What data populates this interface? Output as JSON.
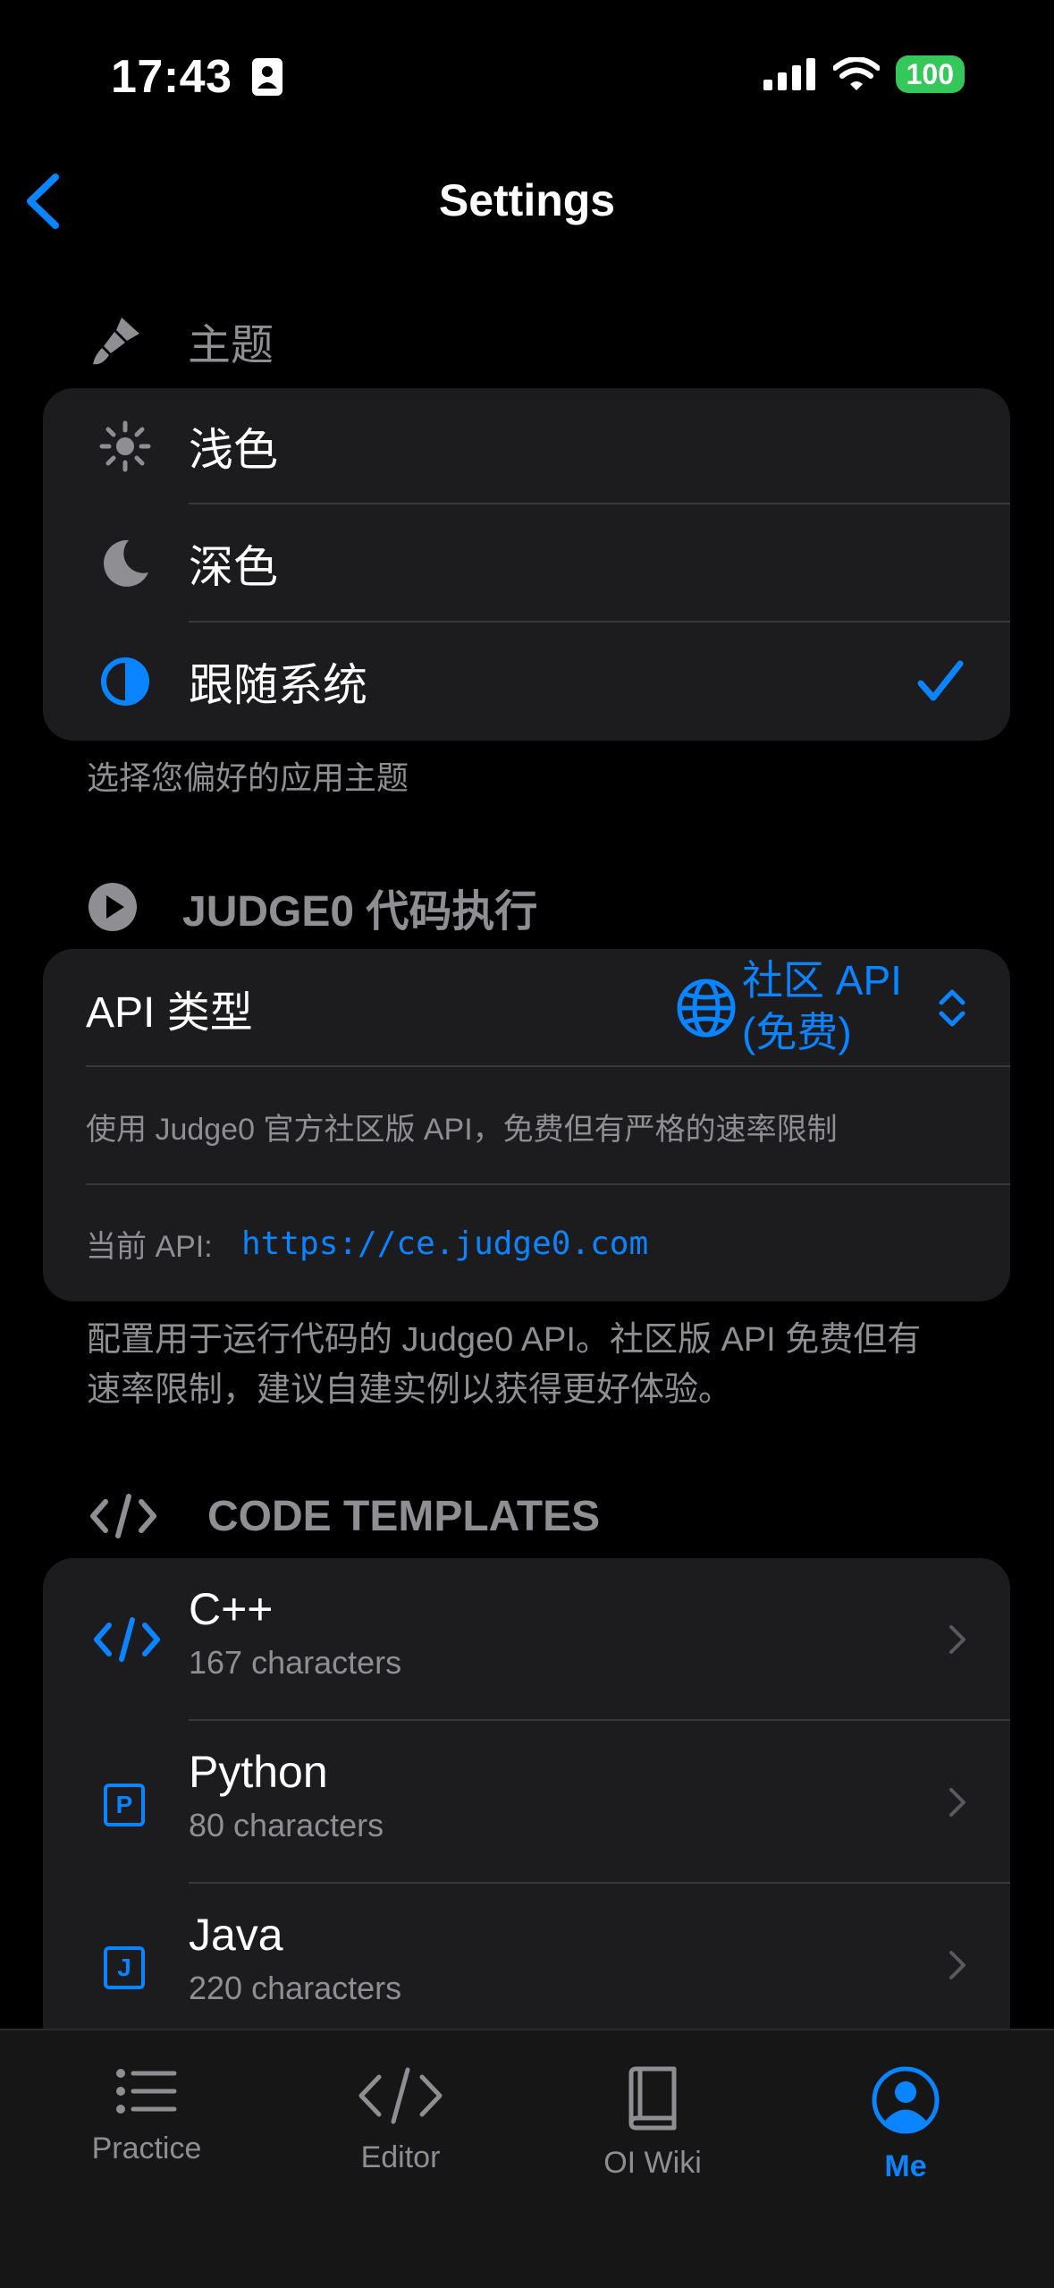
{
  "status": {
    "time": "17:43",
    "battery": "100"
  },
  "nav": {
    "title": "Settings"
  },
  "theme": {
    "header": "主题",
    "options": [
      {
        "label": "浅色",
        "icon": "sun-icon"
      },
      {
        "label": "深色",
        "icon": "moon-icon"
      },
      {
        "label": "跟随系统",
        "icon": "half-circle-icon",
        "selected": true
      }
    ],
    "footer": "选择您偏好的应用主题"
  },
  "judge0": {
    "header": "JUDGE0 代码执行",
    "api_type_label": "API 类型",
    "api_type_value_line1": "社区 API",
    "api_type_value_line2": "(免费)",
    "description": "使用 Judge0 官方社区版 API，免费但有严格的速率限制",
    "current_api_label": "当前 API:",
    "current_api_url": "https://ce.judge0.com",
    "footer_line1": "配置用于运行代码的 Judge0 API。社区版 API 免费但有",
    "footer_line2": "速率限制，建议自建实例以获得更好体验。"
  },
  "templates": {
    "header": "CODE TEMPLATES",
    "items": [
      {
        "name": "C++",
        "detail": "167 characters",
        "icon": "code-icon"
      },
      {
        "name": "Python",
        "detail": "80 characters",
        "icon": "letter-p-icon",
        "letter": "P"
      },
      {
        "name": "Java",
        "detail": "220 characters",
        "icon": "letter-j-icon",
        "letter": "J"
      }
    ]
  },
  "tabs": [
    {
      "label": "Practice",
      "icon": "list-icon"
    },
    {
      "label": "Editor",
      "icon": "code-icon"
    },
    {
      "label": "OI Wiki",
      "icon": "book-icon"
    },
    {
      "label": "Me",
      "icon": "person-circle-icon",
      "active": true
    }
  ],
  "colors": {
    "accent": "#0a84ff",
    "card": "#1c1c1e",
    "secondary": "#8e8e93",
    "battery": "#34c759"
  }
}
